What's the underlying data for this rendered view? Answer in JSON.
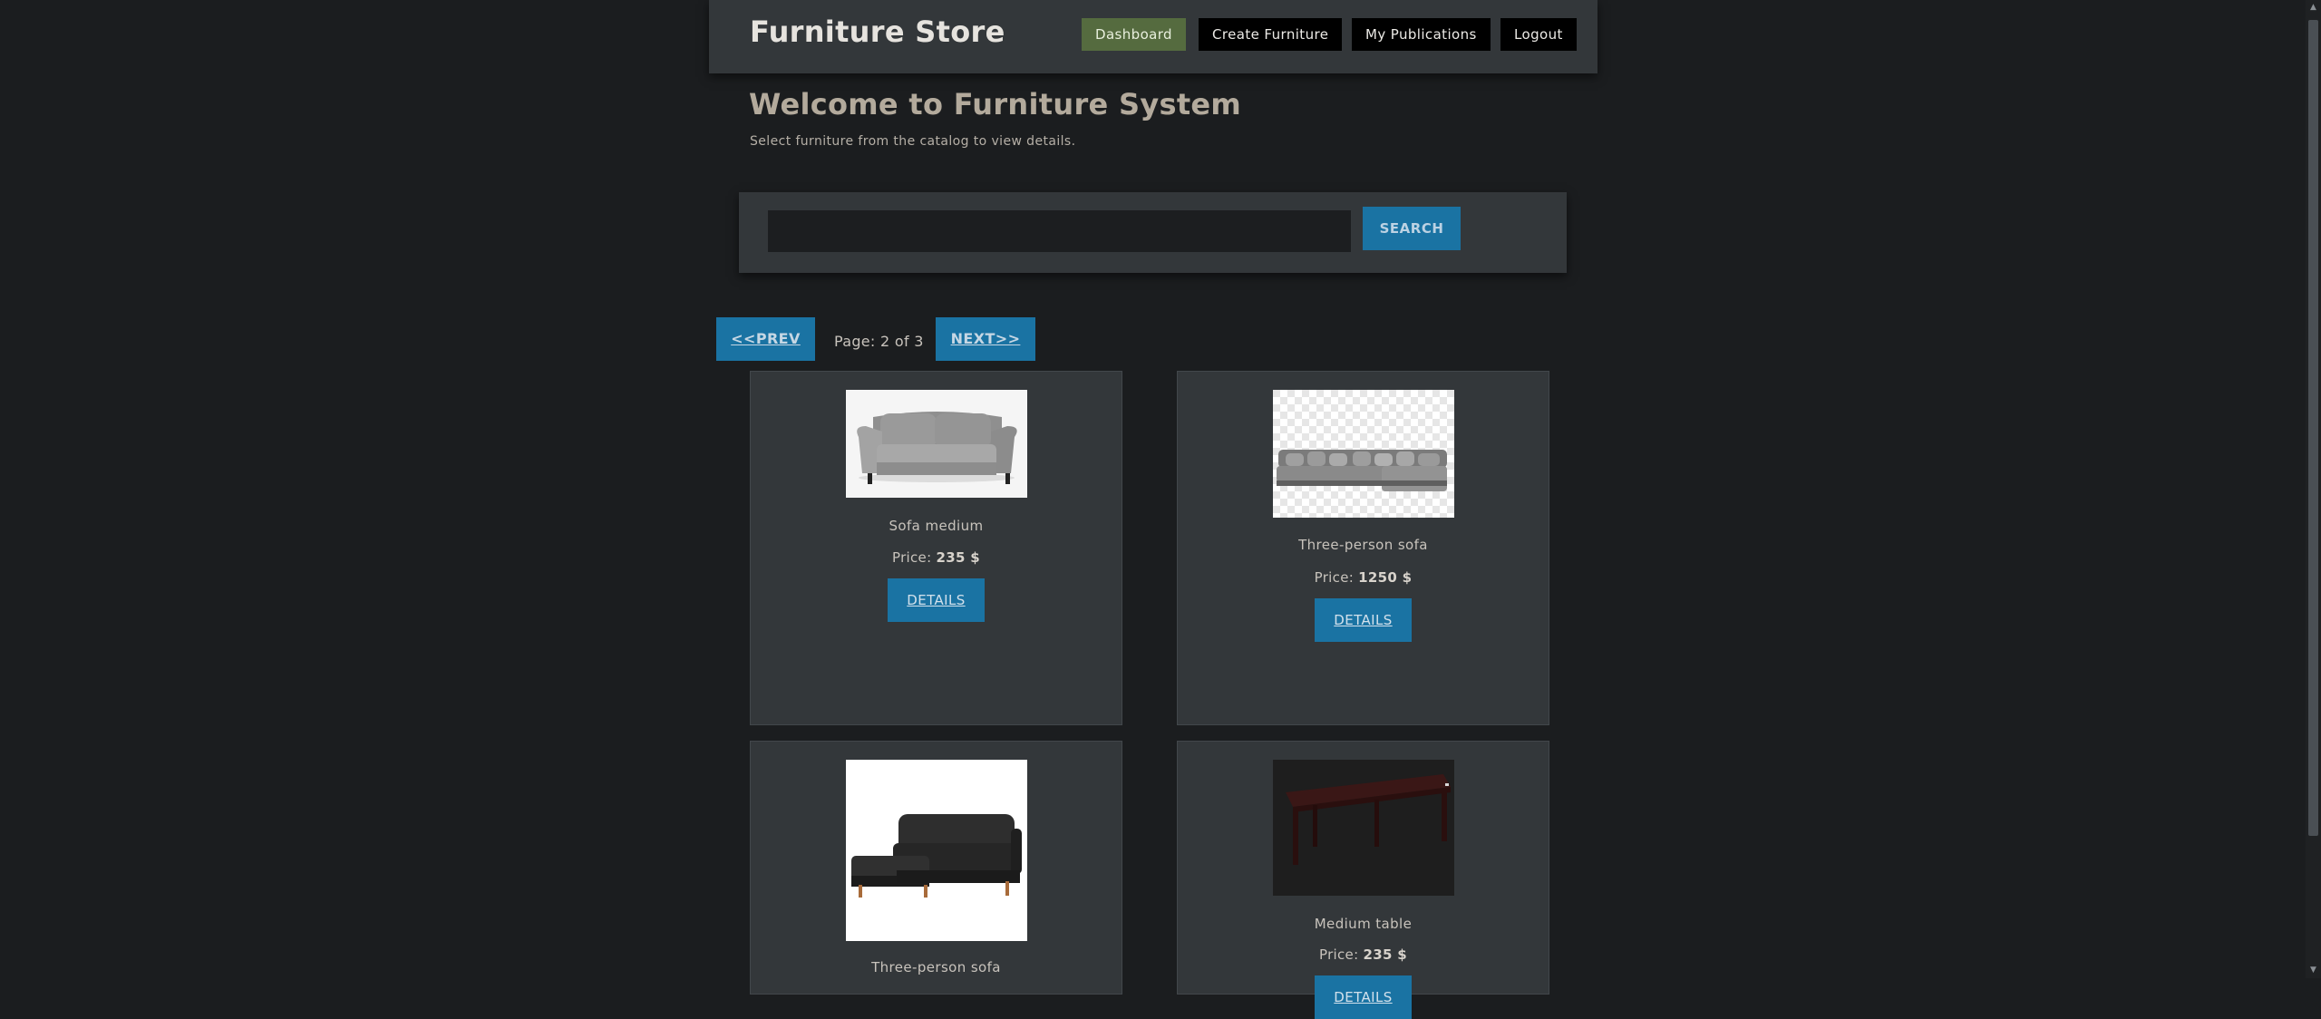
{
  "navbar": {
    "brand": "Furniture Store",
    "links": [
      {
        "label": "Dashboard",
        "active": true
      },
      {
        "label": "Create Furniture",
        "active": false
      },
      {
        "label": "My Publications",
        "active": false
      },
      {
        "label": "Logout",
        "active": false
      }
    ]
  },
  "welcome": {
    "title": "Welcome to Furniture System",
    "subtitle": "Select furniture from the catalog to view details."
  },
  "search": {
    "value": "",
    "button_label": "SEARCH"
  },
  "pagination": {
    "prev_label": "<<PREV",
    "page_text": "Page: 2 of 3",
    "next_label": "NEXT>>"
  },
  "catalog": {
    "price_prefix": "Price:",
    "details_label": "DETAILS",
    "items": [
      {
        "name": "Sofa medium",
        "price": "235 $",
        "image": "grey-sofa-image"
      },
      {
        "name": "Three-person sofa",
        "price": "1250 $",
        "image": "sectional-sofa-image"
      },
      {
        "name": "Three-person sofa",
        "price": "",
        "image": "black-corner-sofa-image"
      },
      {
        "name": "Medium table",
        "price": "235 $",
        "image": "dark-table-image"
      }
    ]
  },
  "colors": {
    "background": "#1b1d1f",
    "panel": "#33373a",
    "accent_blue": "#1a73a3",
    "active_green": "#556b3f"
  }
}
